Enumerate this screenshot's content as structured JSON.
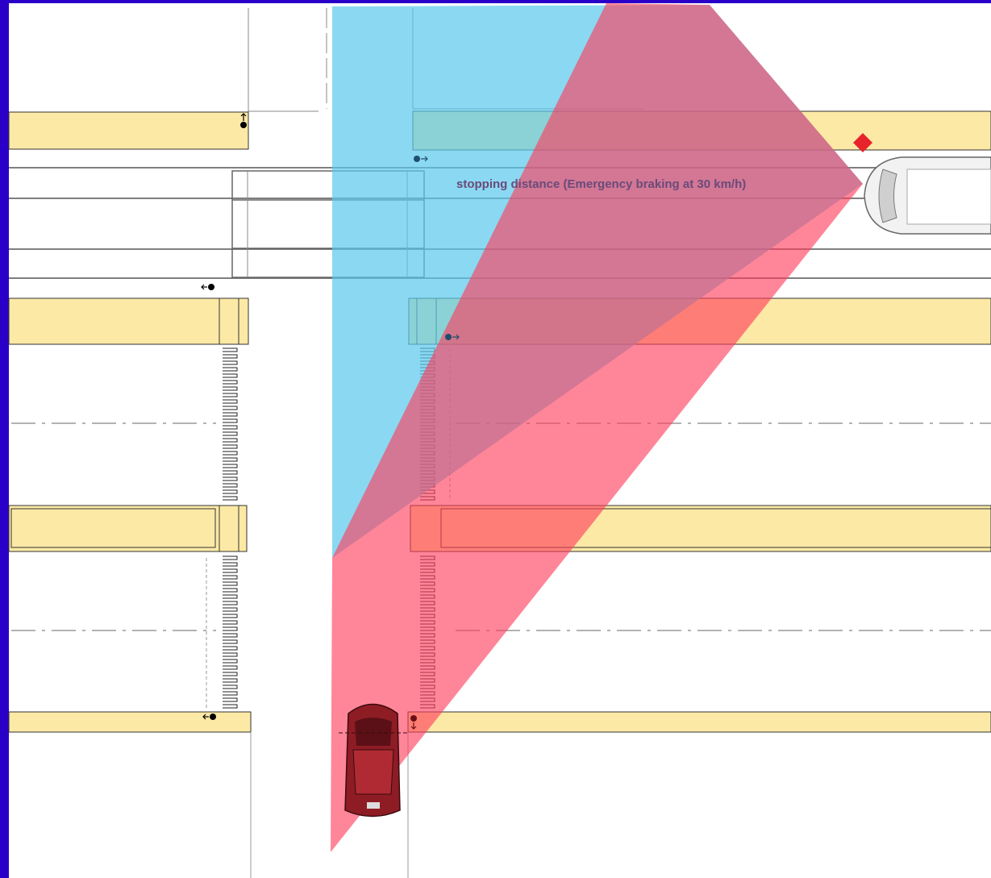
{
  "annotation": {
    "text": "stopping distance (Emergency braking at 30 km/h)"
  },
  "colors": {
    "frame": "#2a00c8",
    "background": "#ffffff",
    "sidewalk": "#fde9a6",
    "road_line": "#555555",
    "visibility_cone_van": "#5ac8ec",
    "visibility_cone_car": "#ff3c5a",
    "conflict_point": "#e8232a",
    "pedestrian_blue": "#1f4f6e",
    "pedestrian_black": "#000000",
    "car_body": "#8e1c24",
    "van_body": "#f2f2f2",
    "annotation_text": "#6a4a7a"
  },
  "icons": {
    "conflict_marker": "red-diamond-icon",
    "pedestrian": "pedestrian-arrow-icon",
    "car": "red-car-icon",
    "van": "white-van-icon"
  }
}
